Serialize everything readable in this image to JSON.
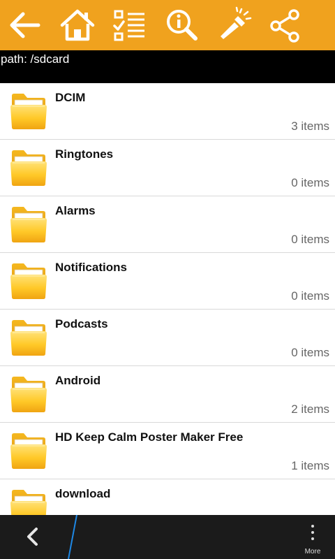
{
  "toolbar": {
    "buttons": [
      {
        "icon": "back-arrow-icon"
      },
      {
        "icon": "home-icon"
      },
      {
        "icon": "checklist-icon"
      },
      {
        "icon": "info-search-icon"
      },
      {
        "icon": "flashlight-icon"
      },
      {
        "icon": "share-icon"
      }
    ],
    "color": "#f0a21e"
  },
  "path": {
    "text": "path: /sdcard"
  },
  "folders": [
    {
      "name": "DCIM",
      "count": "3 items"
    },
    {
      "name": "Ringtones",
      "count": "0 items"
    },
    {
      "name": "Alarms",
      "count": "0 items"
    },
    {
      "name": "Notifications",
      "count": "0 items"
    },
    {
      "name": "Podcasts",
      "count": "0 items"
    },
    {
      "name": "Android",
      "count": "2 items"
    },
    {
      "name": "HD Keep Calm Poster Maker Free",
      "count": "1 items"
    },
    {
      "name": "download",
      "count": ""
    }
  ],
  "bottom_bar": {
    "more_label": "More",
    "accent": "#1e88e5"
  }
}
